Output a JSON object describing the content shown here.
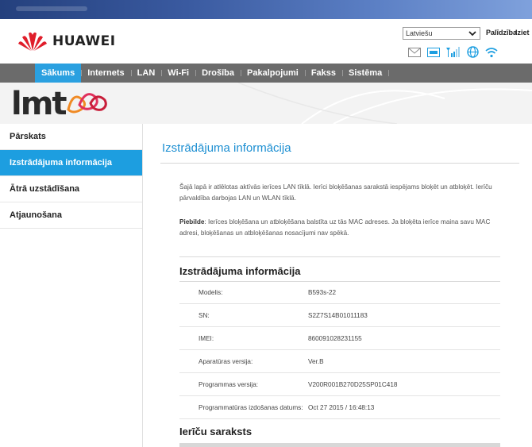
{
  "brand": {
    "name": "HUAWEI",
    "logo_icon": "huawei-petal-logo",
    "accent": "#e01e2b"
  },
  "header": {
    "language_select": {
      "value": "Latviešu"
    },
    "help_link": "Palīdzība",
    "logout_link": "Iziet",
    "status_icons": [
      "envelope-icon",
      "lte-icon",
      "signal-icon",
      "globe-icon",
      "wifi-icon"
    ]
  },
  "nav": {
    "items": [
      {
        "label": "Sākums",
        "active": true
      },
      {
        "label": "Internets"
      },
      {
        "label": "LAN"
      },
      {
        "label": "Wi-Fi"
      },
      {
        "label": "Drošība"
      },
      {
        "label": "Pakalpojumi"
      },
      {
        "label": "Fakss"
      },
      {
        "label": "Sistēma"
      }
    ],
    "active_color": "#2aa0e0",
    "bar_color": "#6b6b6b"
  },
  "banner": {
    "operator_text": "lmt"
  },
  "sidebar": {
    "items": [
      {
        "label": "Pārskats"
      },
      {
        "label": "Izstrādājuma informācija",
        "active": true
      },
      {
        "label": "Ātrā uzstādīšana"
      },
      {
        "label": "Atjaunošana"
      }
    ]
  },
  "content": {
    "title": "Izstrādājuma informācija",
    "intro": "Šajā lapā ir atlēlotas aktīvās ierīces LAN tīklā. Ierīci bloķēšanas sarakstā iespējams bloķēt un atbloķēt. Ierīču pārvaldība darbojas LAN un WLAN tīklā.",
    "note_label": "Piebilde",
    "note_text": ": Ierīces bloķēšana un atbloķēšana balstīta uz tās MAC adreses. Ja bloķēta ierīce maina savu MAC adresi, bloķēšanas un atbloķēšanas nosacījumi nav spēkā.",
    "info_section_title": "Izstrādājuma informācija",
    "info_rows": [
      {
        "key": "Modelis:",
        "value": "B593s-22"
      },
      {
        "key": "SN:",
        "value": "S2Z7S14B01011183"
      },
      {
        "key": "IMEI:",
        "value": "860091028231155"
      },
      {
        "key": "Aparatūras versija:",
        "value": "Ver.B"
      },
      {
        "key": "Programmas versija:",
        "value": "V200R001B270D25SP01C418"
      },
      {
        "key": "Programmatūras izdošanas datums:",
        "value": "Oct 27 2015 / 16:48:13"
      }
    ],
    "device_list_title": "Ierīču saraksts"
  }
}
